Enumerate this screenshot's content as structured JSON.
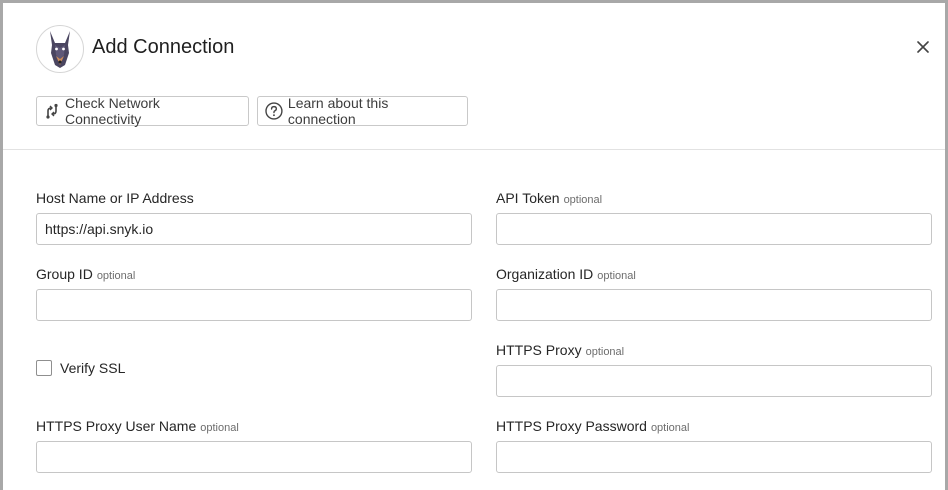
{
  "dialog": {
    "title": "Add Connection",
    "close_icon": "close-icon",
    "logo_icon": "doberman-logo-icon"
  },
  "toolbar": {
    "check_network_label": "Check Network Connectivity",
    "check_network_icon": "network-check-icon",
    "learn_label": "Learn about this connection",
    "learn_icon": "help-circle-icon"
  },
  "form": {
    "optional_text": "optional",
    "host": {
      "label": "Host Name or IP Address",
      "value": "https://api.snyk.io"
    },
    "api_token": {
      "label": "API Token",
      "value": ""
    },
    "group_id": {
      "label": "Group ID",
      "value": ""
    },
    "organization_id": {
      "label": "Organization ID",
      "value": ""
    },
    "verify_ssl": {
      "label": "Verify SSL",
      "checked": false
    },
    "https_proxy": {
      "label": "HTTPS Proxy",
      "value": ""
    },
    "https_proxy_user": {
      "label": "HTTPS Proxy User Name",
      "value": ""
    },
    "https_proxy_password": {
      "label": "HTTPS Proxy Password",
      "value": ""
    }
  }
}
